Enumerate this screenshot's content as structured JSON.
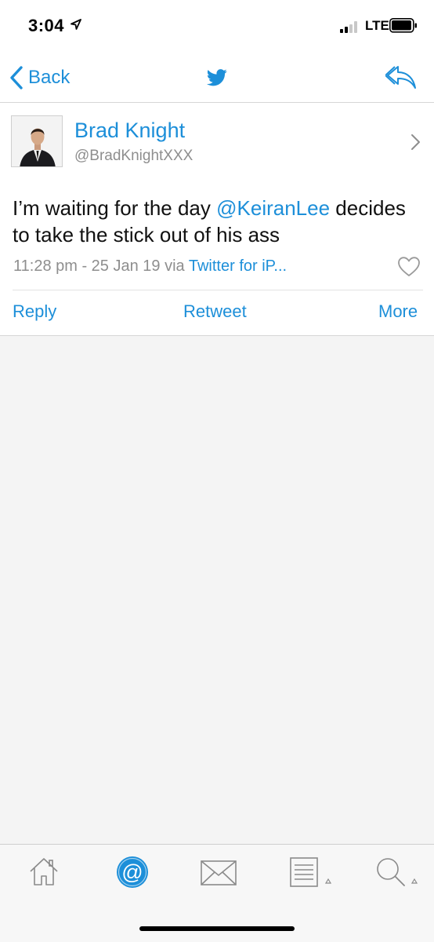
{
  "status_bar": {
    "time": "3:04",
    "network": "LTE"
  },
  "nav": {
    "back_label": "Back",
    "center_icon": "twitter-bird-icon",
    "right_icon": "reply-all-icon"
  },
  "tweet": {
    "author_name": "Brad Knight",
    "author_handle": "@BradKnightXXX",
    "text_before": "I’m waiting for the day ",
    "mention": "@KeiranLee",
    "text_after": " decides to take the stick out of his ass",
    "meta_prefix": "11:28 pm - 25 Jan 19 via ",
    "client": "Twitter for iP..."
  },
  "actions": {
    "reply": "Reply",
    "retweet": "Retweet",
    "more": "More"
  },
  "tabs": [
    {
      "icon": "home-icon"
    },
    {
      "icon": "mentions-icon"
    },
    {
      "icon": "messages-icon"
    },
    {
      "icon": "lists-icon"
    },
    {
      "icon": "search-icon"
    }
  ],
  "colors": {
    "accent": "#1d8fd9",
    "secondary_text": "#8e8e8e",
    "background": "#f4f4f4"
  }
}
